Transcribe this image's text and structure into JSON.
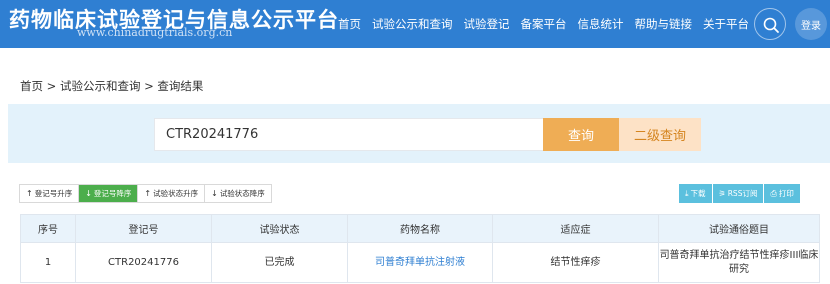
{
  "header": {
    "site_title": "药物临床试验登记与信息公示平台",
    "site_url": "www.chinadrugtrials.org.cn",
    "nav": [
      "首页",
      "试验公示和查询",
      "试验登记",
      "备案平台",
      "信息统计",
      "帮助与链接",
      "关于平台"
    ],
    "login_label": "登录"
  },
  "breadcrumb": "首页 > 试验公示和查询 > 查询结果",
  "search": {
    "value": "CTR20241776",
    "query_label": "查询",
    "advanced_label": "二级查询"
  },
  "sort_buttons": [
    {
      "label": "登记号升序",
      "arrow": "↑",
      "active": false
    },
    {
      "label": "登记号降序",
      "arrow": "↓",
      "active": true
    },
    {
      "label": "试验状态升序",
      "arrow": "↑",
      "active": false
    },
    {
      "label": "试验状态降序",
      "arrow": "↓",
      "active": false
    }
  ],
  "tools": {
    "download": "下载",
    "rss": "RSS订阅",
    "print": "打印"
  },
  "table": {
    "headers": [
      "序号",
      "登记号",
      "试验状态",
      "药物名称",
      "适应症",
      "试验通俗题目"
    ],
    "rows": [
      [
        "1",
        "CTR20241776",
        "已完成",
        "司普奇拜单抗注射液",
        "结节性痒疹",
        "司普奇拜单抗治疗结节性痒疹III临床研究"
      ]
    ]
  },
  "colors": {
    "header_bg": "#2f7fd2",
    "query_btn": "#efad55",
    "advanced_btn": "#fde2c6",
    "active_sort": "#4cae4c",
    "tool_btn": "#5bc0de"
  }
}
